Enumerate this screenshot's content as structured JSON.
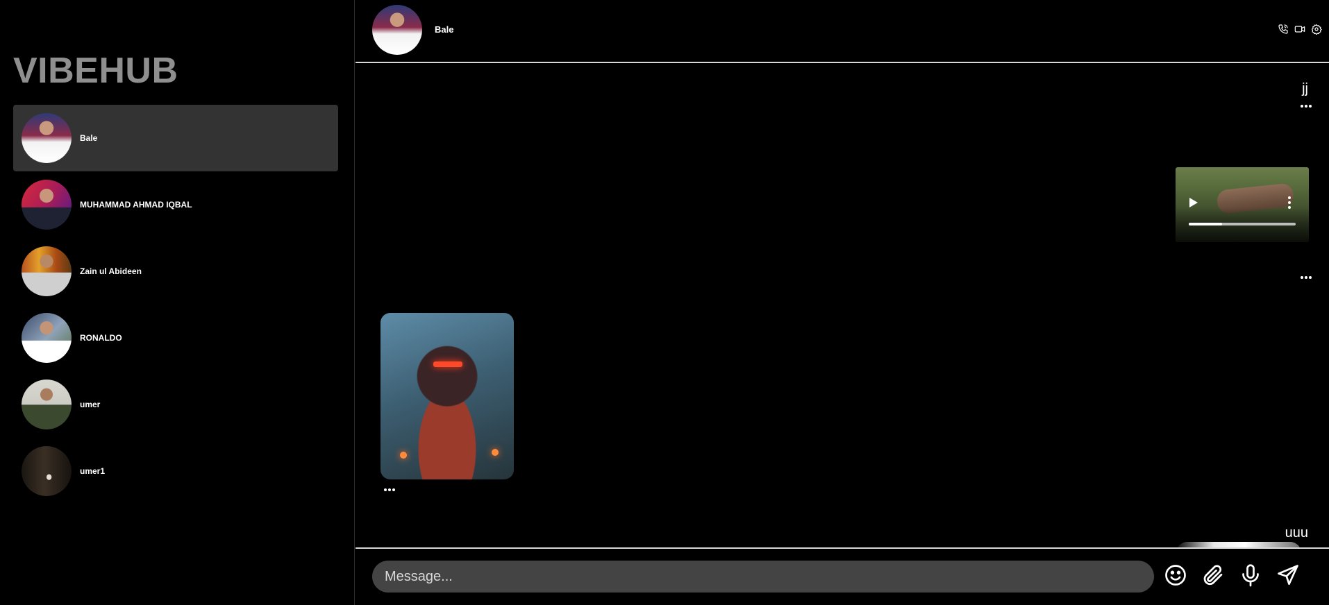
{
  "app": {
    "brand": "VIBEHUB"
  },
  "sidebar": {
    "contacts": [
      {
        "name": "Bale",
        "avatar": "avatar-bale",
        "active": true
      },
      {
        "name": "MUHAMMAD AHMAD IQBAL",
        "avatar": "avatar-muhammad-ahmad-iqbal"
      },
      {
        "name": "Zain ul Abideen",
        "avatar": "avatar-zain-ul-abideen"
      },
      {
        "name": "RONALDO",
        "avatar": "avatar-ronaldo"
      },
      {
        "name": "umer",
        "avatar": "avatar-umer"
      },
      {
        "name": "umer1",
        "avatar": "avatar-umer1"
      }
    ]
  },
  "chat": {
    "header": {
      "name": "Bale",
      "icons": [
        "phone-icon",
        "video-call-icon",
        "settings-icon"
      ]
    },
    "messages": [
      {
        "type": "text",
        "side": "right",
        "text": "jj"
      },
      {
        "type": "video",
        "side": "right",
        "progress": 0.31
      },
      {
        "type": "image",
        "side": "left",
        "description_icon": "armored-robot-image"
      },
      {
        "type": "text",
        "side": "right",
        "text": "uuu"
      }
    ],
    "composer": {
      "placeholder": "Message...",
      "icons": [
        "emoji-icon",
        "attach-icon",
        "microphone-icon",
        "send-icon"
      ]
    }
  }
}
